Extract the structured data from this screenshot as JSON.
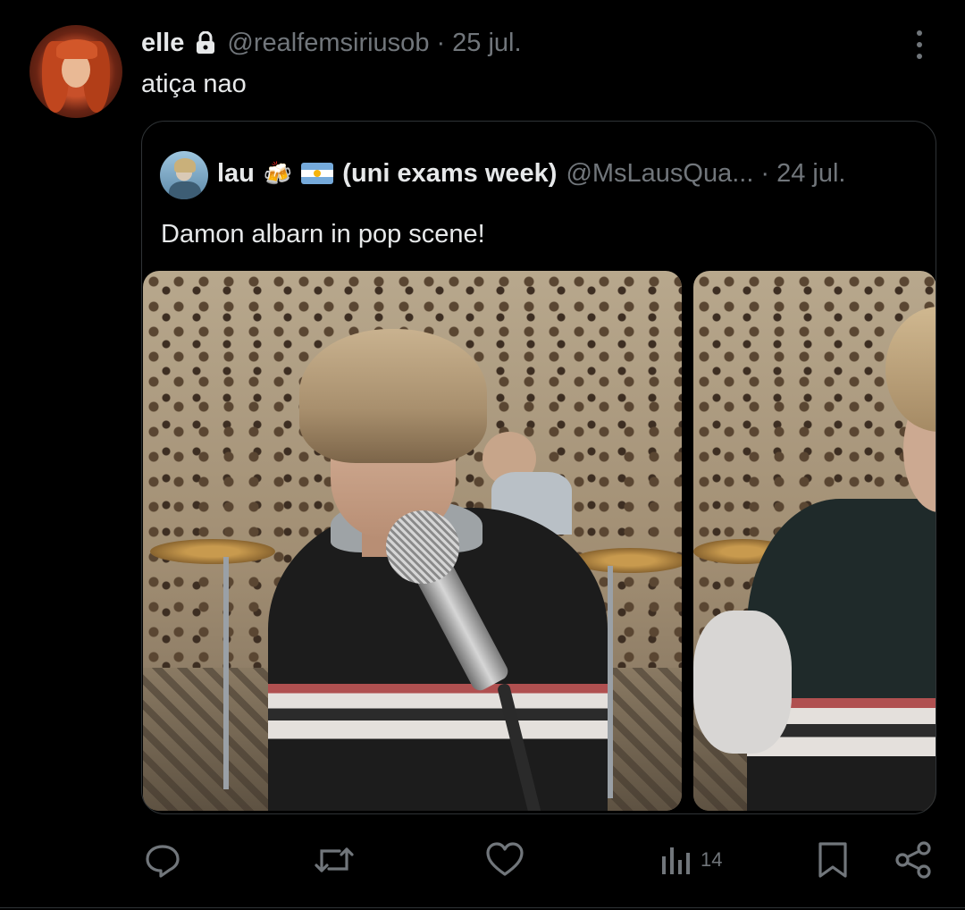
{
  "tweet": {
    "author_name": "elle",
    "handle": "@realfemsiriusob",
    "separator": "·",
    "date": "25 jul.",
    "text": "atiça nao",
    "avatar_icon": "avatar-photo-red-hair"
  },
  "quoted_tweet": {
    "author_name": "lau",
    "beer_emoji": "🍻",
    "flag_icon": "argentina-flag-icon",
    "name_suffix": "(uni exams week)",
    "handle": "@MsLausQua...",
    "separator": "·",
    "date": "24 jul.",
    "text": "Damon albarn in pop scene!",
    "images": [
      {
        "icon": "photo-singer-microphone"
      },
      {
        "icon": "photo-band-member"
      }
    ]
  },
  "actions": {
    "reply_icon": "reply-icon",
    "retweet_icon": "retweet-icon",
    "like_icon": "heart-icon",
    "views_icon": "views-icon",
    "views_count": "14",
    "bookmark_icon": "bookmark-icon",
    "share_icon": "share-icon"
  },
  "colors": {
    "background": "#000000",
    "text": "#e7e9ea",
    "secondary": "#71767b",
    "border": "#2f3336"
  }
}
